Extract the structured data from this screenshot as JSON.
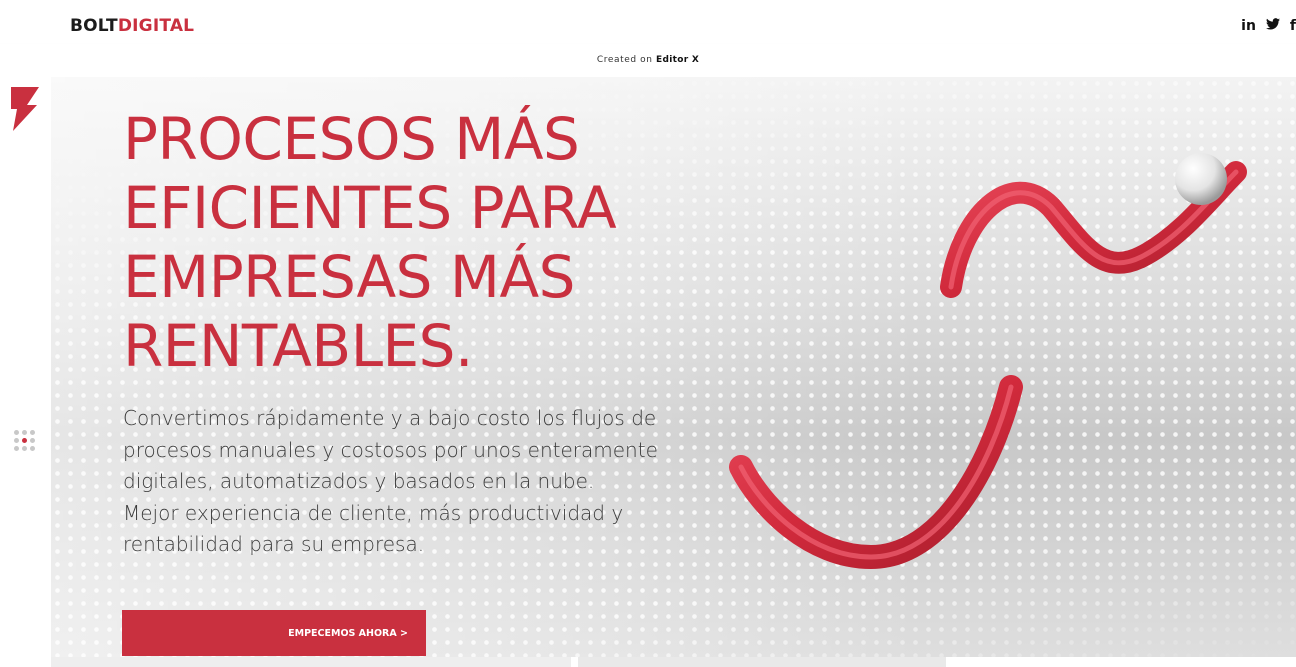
{
  "header": {
    "logo_part1": "BOLT",
    "logo_part2": "DIGITAL",
    "social": {
      "linkedin": "in",
      "twitter_icon": "twitter-bird-icon",
      "facebook": "f"
    }
  },
  "credit": {
    "prefix": "Created on",
    "brand": "Editor X"
  },
  "sidebar": {
    "brand_icon": "bolt-flag-icon",
    "menu_icon": "grid-dots-menu-icon"
  },
  "hero": {
    "headline_lines": [
      "PROCESOS MÁS",
      "EFICIENTES PARA",
      "EMPRESAS MÁS",
      "RENTABLES."
    ],
    "subcopy_lines": [
      "Convertimos rápidamente y a bajo costo los flujos de",
      "procesos manuales y costosos por unos enteramente",
      "digitales, automatizados y basados en la nube.",
      "Mejor experiencia de cliente, más productividad y",
      "rentabilidad para su empresa."
    ],
    "cta_label": "EMPECEMOS AHORA >"
  },
  "colors": {
    "brand_red": "#c9303f",
    "dark_text": "#1c1c1c",
    "body_text": "#3a3a3a"
  }
}
